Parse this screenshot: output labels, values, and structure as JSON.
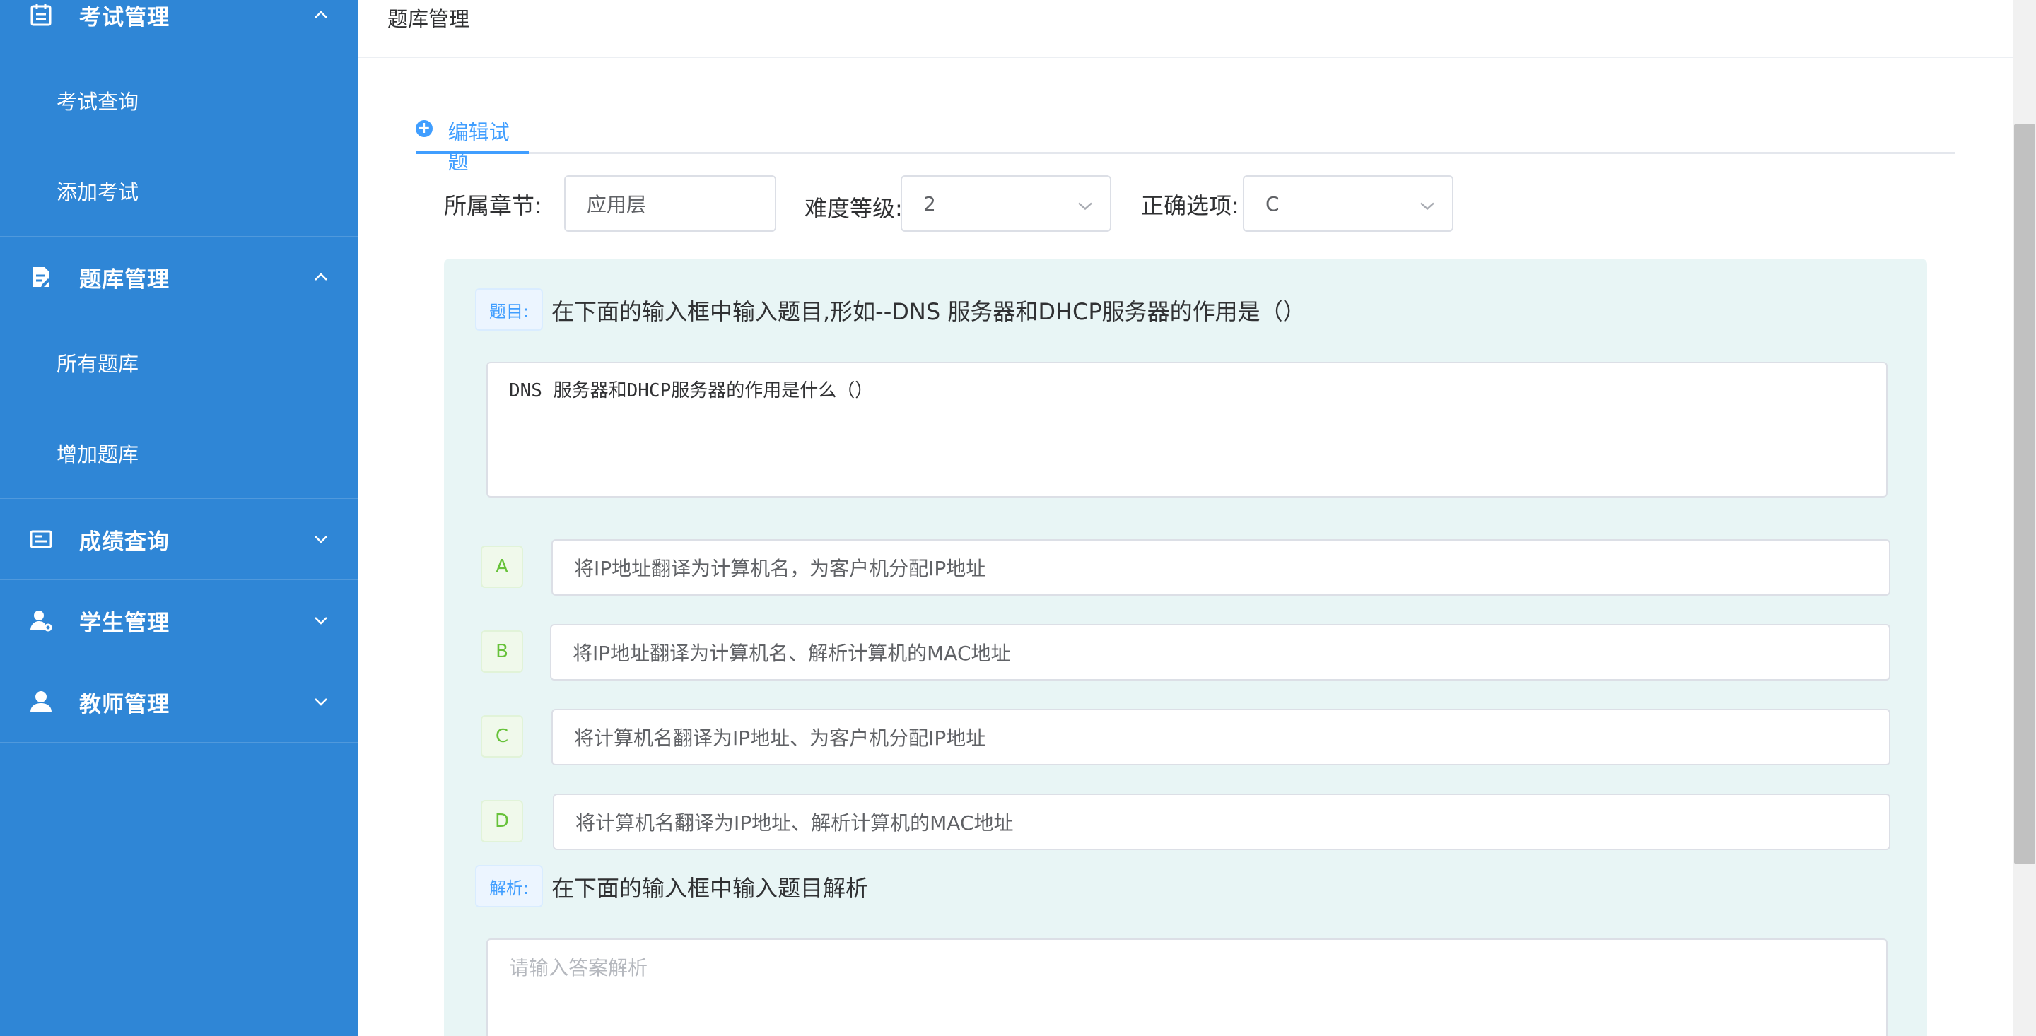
{
  "sidebar": {
    "groups": [
      {
        "label": "考试管理",
        "icon": "calendar-icon",
        "expanded": true,
        "items": [
          {
            "label": "考试查询"
          },
          {
            "label": "添加考试"
          }
        ]
      },
      {
        "label": "题库管理",
        "icon": "edit-document-icon",
        "expanded": true,
        "items": [
          {
            "label": "所有题库"
          },
          {
            "label": "增加题库"
          }
        ]
      },
      {
        "label": "成绩查询",
        "icon": "scorecard-icon",
        "expanded": false,
        "items": []
      },
      {
        "label": "学生管理",
        "icon": "user-settings-icon",
        "expanded": false,
        "items": []
      },
      {
        "label": "教师管理",
        "icon": "user-icon",
        "expanded": false,
        "items": []
      }
    ]
  },
  "header": {
    "breadcrumb": "题库管理"
  },
  "tabs": {
    "active_label": "编辑试题"
  },
  "form": {
    "chapter_label": "所属章节:",
    "chapter_value": "应用层",
    "difficulty_label": "难度等级:",
    "difficulty_value": "2",
    "answer_label": "正确选项:",
    "answer_value": "C"
  },
  "question": {
    "tag": "题目:",
    "hint": "在下面的输入框中输入题目,形如--DNS 服务器和DHCP服务器的作用是（）",
    "text": "DNS 服务器和DHCP服务器的作用是什么（）"
  },
  "options": [
    {
      "key": "A",
      "text": "将IP地址翻译为计算机名，为客户机分配IP地址"
    },
    {
      "key": "B",
      "text": "将IP地址翻译为计算机名、解析计算机的MAC地址"
    },
    {
      "key": "C",
      "text": "将计算机名翻译为IP地址、为客户机分配IP地址"
    },
    {
      "key": "D",
      "text": "将计算机名翻译为IP地址、解析计算机的MAC地址"
    }
  ],
  "analysis": {
    "tag": "解析:",
    "hint": "在下面的输入框中输入题目解析",
    "placeholder": "请输入答案解析"
  },
  "colors": {
    "sidebar": "#2f86d6",
    "accent": "#409eff",
    "panel": "#e8f5f5",
    "option_tag": "#67c23a"
  }
}
